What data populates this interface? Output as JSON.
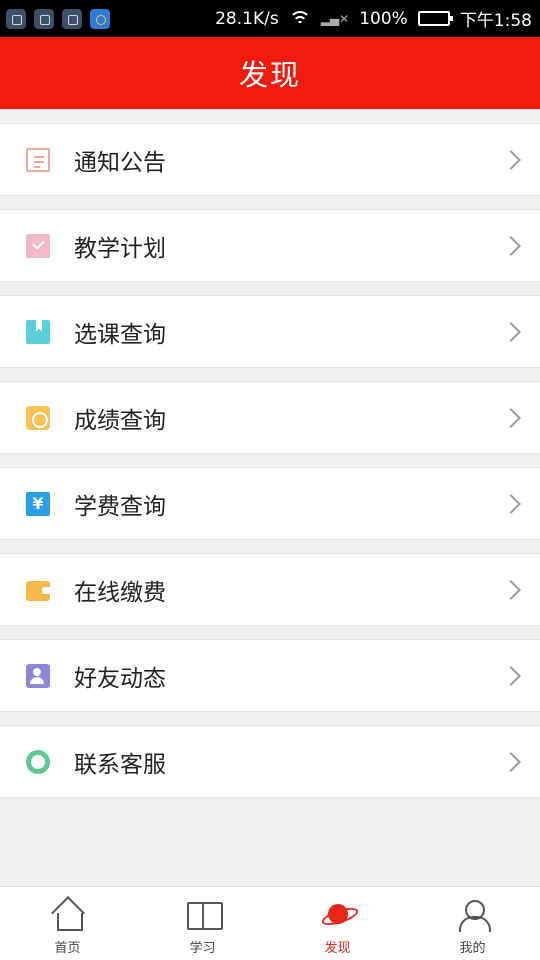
{
  "status_bar": {
    "speed": "28.1K/s",
    "battery": "100%",
    "time": "下午1:58"
  },
  "header": {
    "title": "发现"
  },
  "menu": {
    "items": [
      {
        "label": "通知公告",
        "icon": "notice-icon"
      },
      {
        "label": "教学计划",
        "icon": "plan-icon"
      },
      {
        "label": "选课查询",
        "icon": "course-icon"
      },
      {
        "label": "成绩查询",
        "icon": "grade-icon"
      },
      {
        "label": "学费查询",
        "icon": "tuition-icon"
      },
      {
        "label": "在线缴费",
        "icon": "wallet-icon"
      },
      {
        "label": "好友动态",
        "icon": "friends-icon"
      },
      {
        "label": "联系客服",
        "icon": "service-icon"
      }
    ]
  },
  "bottom_nav": {
    "items": [
      {
        "label": "首页",
        "icon": "home-icon",
        "active": false
      },
      {
        "label": "学习",
        "icon": "book-icon",
        "active": false
      },
      {
        "label": "发现",
        "icon": "planet-icon",
        "active": true
      },
      {
        "label": "我的",
        "icon": "user-icon",
        "active": false
      }
    ]
  },
  "colors": {
    "header_bg": "#f01b0c",
    "active_nav": "#e8251b",
    "page_bg": "#efefef"
  }
}
